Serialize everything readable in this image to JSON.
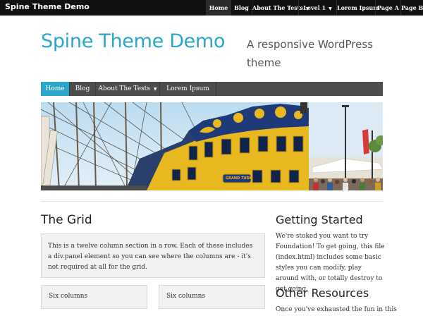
{
  "topbar": {
    "site_name": "Spine Theme Demo",
    "nav": [
      {
        "label": "Home",
        "active": true
      },
      {
        "label": "Blog"
      },
      {
        "label": "About The Tests",
        "dropdown": true
      },
      {
        "label": "Level 1",
        "dropdown": true
      },
      {
        "label": "Lorem Ipsum"
      },
      {
        "label": "Page A"
      },
      {
        "label": "Page B"
      }
    ]
  },
  "header": {
    "title": "Spine Theme Demo",
    "tagline": "A responsive WordPress theme"
  },
  "mainnav": {
    "items": [
      {
        "label": "Home",
        "active": true
      },
      {
        "label": "Blog"
      },
      {
        "label": "About The Tests",
        "dropdown": true
      },
      {
        "label": "Lorem Ipsum"
      }
    ]
  },
  "content": {
    "grid_title": "The Grid",
    "panel_text": "This is a twelve column section in a row. Each of these includes a div.panel element so you can see where the columns are - it's not required at all for the grid.",
    "col_left": "Six columns",
    "col_right": "Six columns"
  },
  "sidebar": {
    "getting_started_title": "Getting Started",
    "getting_started_text": "We're stoked you want to try Foundation! To get going, this file (index.html) includes some basic styles you can modify, play around with, or totally destroy to get going.",
    "other_resources_title": "Other Resources",
    "other_resources_text": "Once you've exhausted the fun in this"
  },
  "hero": {
    "nameplate": "GRAND TURK"
  },
  "colors": {
    "accent": "#2ba6cb",
    "topbar": "#111111",
    "mainnav": "#4d4d4d",
    "panel_bg": "#f2f2f2"
  }
}
